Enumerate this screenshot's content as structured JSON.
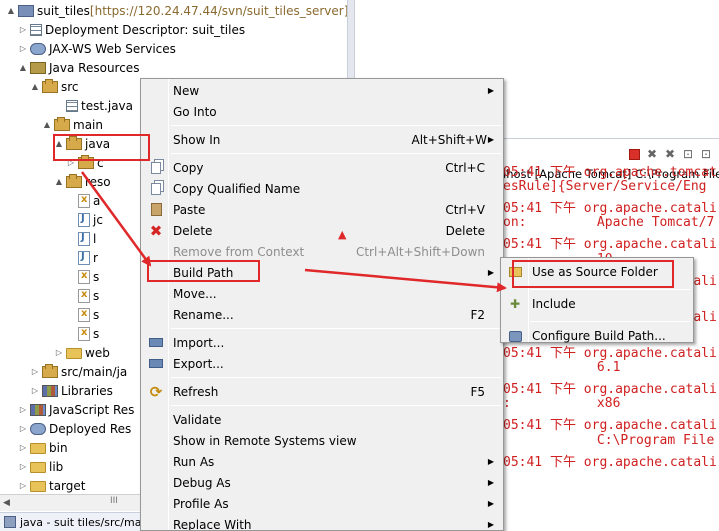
{
  "explorer": {
    "items": [
      {
        "indent": 0,
        "twisty": "▲",
        "icon": "proj",
        "icon_name": "project-icon",
        "label": "suit_tiles",
        "extra": " [https://120.24.47.44/svn/suit_tiles_server]"
      },
      {
        "indent": 1,
        "twisty": "▷",
        "icon": "grid",
        "icon_name": "deployment-descriptor-icon",
        "label": "Deployment Descriptor: suit_tiles"
      },
      {
        "indent": 1,
        "twisty": "▷",
        "icon": "ws",
        "icon_name": "web-services-icon",
        "label": "JAX-WS Web Services"
      },
      {
        "indent": 1,
        "twisty": "▲",
        "icon": "jsr",
        "icon_name": "java-resources-icon",
        "label": "Java Resources"
      },
      {
        "indent": 2,
        "twisty": "▲",
        "icon": "pkg",
        "icon_name": "source-folder-icon",
        "label": "src"
      },
      {
        "indent": 4,
        "twisty": "",
        "icon": "grid",
        "icon_name": "java-file-icon",
        "label": "test.java"
      },
      {
        "indent": 3,
        "twisty": "▲",
        "icon": "pkg",
        "icon_name": "package-icon",
        "label": "main"
      },
      {
        "indent": 4,
        "twisty": "▲",
        "icon": "pkg",
        "icon_name": "package-icon",
        "label": "java"
      },
      {
        "indent": 5,
        "twisty": "▷",
        "icon": "pkg",
        "icon_name": "package-icon",
        "label": "c"
      },
      {
        "indent": 4,
        "twisty": "▲",
        "icon": "pkg",
        "icon_name": "package-icon",
        "label": "reso"
      },
      {
        "indent": 5,
        "twisty": "",
        "icon": "xml",
        "icon_name": "xml-file-icon",
        "label": "a"
      },
      {
        "indent": 5,
        "twisty": "",
        "icon": "java",
        "icon_name": "file-icon",
        "label": "jc"
      },
      {
        "indent": 5,
        "twisty": "",
        "icon": "java",
        "icon_name": "file-icon",
        "label": "l"
      },
      {
        "indent": 5,
        "twisty": "",
        "icon": "java",
        "icon_name": "file-icon",
        "label": "r"
      },
      {
        "indent": 5,
        "twisty": "",
        "icon": "xml",
        "icon_name": "xml-file-icon",
        "label": "s"
      },
      {
        "indent": 5,
        "twisty": "",
        "icon": "xml",
        "icon_name": "xml-file-icon",
        "label": "s"
      },
      {
        "indent": 5,
        "twisty": "",
        "icon": "xml",
        "icon_name": "xml-file-icon",
        "label": "s"
      },
      {
        "indent": 5,
        "twisty": "",
        "icon": "xml",
        "icon_name": "xml-file-icon",
        "label": "s"
      },
      {
        "indent": 4,
        "twisty": "▷",
        "icon": "folder",
        "icon_name": "folder-icon",
        "label": "web"
      },
      {
        "indent": 2,
        "twisty": "▷",
        "icon": "pkg",
        "icon_name": "source-folder-icon",
        "label": "src/main/ja"
      },
      {
        "indent": 2,
        "twisty": "▷",
        "icon": "lib",
        "icon_name": "libraries-icon",
        "label": "Libraries"
      },
      {
        "indent": 1,
        "twisty": "▷",
        "icon": "lib",
        "icon_name": "javascript-resources-icon",
        "label": "JavaScript Res"
      },
      {
        "indent": 1,
        "twisty": "▷",
        "icon": "ws",
        "icon_name": "deployed-resources-icon",
        "label": "Deployed Res"
      },
      {
        "indent": 1,
        "twisty": "▷",
        "icon": "folder",
        "icon_name": "folder-icon",
        "label": "bin"
      },
      {
        "indent": 1,
        "twisty": "▷",
        "icon": "folder",
        "icon_name": "folder-icon",
        "label": "lib"
      },
      {
        "indent": 1,
        "twisty": "▷",
        "icon": "folder",
        "icon_name": "folder-icon",
        "label": "target"
      }
    ],
    "scroll_left": "◀",
    "scroll_right": "▶",
    "scroll_thumb": "III",
    "status_text": "java - suit tiles/src/ma"
  },
  "console": {
    "header": "lhost [Apache Tomcat] C:\\Program File",
    "toolbar_icons": [
      "■",
      "✖",
      "✖",
      "⊡",
      "⊡"
    ],
    "lines": [
      "05:41 下午 org.apache.tomcat",
      "esRule]{Server/Service/Eng",
      "05:41 下午 org.apache.catali",
      "on:         Apache Tomcat/7",
      "05:41 下午 org.apache.catali",
      "            10",
      "05:41 下午 org.apache.catali",
      "",
      "05:41 下午 org.apache.catali",
      "            Windows 7",
      "05:41 下午 org.apache.catali",
      "            6.1",
      "05:41 下午 org.apache.catali",
      ":           x86",
      "05:41 下午 org.apache.catali",
      "            C:\\Program File",
      "05:41 下午 org.apache.catali"
    ]
  },
  "context_menu": {
    "items": [
      {
        "type": "item",
        "label": "New",
        "shortcut": "",
        "submenu": true,
        "icon": "",
        "name": "menu-item-new"
      },
      {
        "type": "item",
        "label": "Go Into",
        "shortcut": "",
        "submenu": false,
        "icon": "",
        "name": "menu-item-go-into"
      },
      {
        "type": "sep"
      },
      {
        "type": "item",
        "label": "Show In",
        "shortcut": "Alt+Shift+W",
        "submenu": true,
        "icon": "",
        "name": "menu-item-show-in"
      },
      {
        "type": "sep"
      },
      {
        "type": "item",
        "label": "Copy",
        "shortcut": "Ctrl+C",
        "submenu": false,
        "icon": "copy",
        "name": "menu-item-copy"
      },
      {
        "type": "item",
        "label": "Copy Qualified Name",
        "shortcut": "",
        "submenu": false,
        "icon": "copy",
        "name": "menu-item-copy-qualified-name"
      },
      {
        "type": "item",
        "label": "Paste",
        "shortcut": "Ctrl+V",
        "submenu": false,
        "icon": "paste",
        "name": "menu-item-paste"
      },
      {
        "type": "item",
        "label": "Delete",
        "shortcut": "Delete",
        "submenu": false,
        "icon": "del",
        "name": "menu-item-delete"
      },
      {
        "type": "item",
        "label": "Remove from Context",
        "shortcut": "Ctrl+Alt+Shift+Down",
        "submenu": false,
        "icon": "",
        "disabled": true,
        "name": "menu-item-remove-from-context"
      },
      {
        "type": "item",
        "label": "Build Path",
        "shortcut": "",
        "submenu": true,
        "icon": "",
        "name": "menu-item-build-path"
      },
      {
        "type": "item",
        "label": "Move...",
        "shortcut": "",
        "submenu": false,
        "icon": "",
        "name": "menu-item-move"
      },
      {
        "type": "item",
        "label": "Rename...",
        "shortcut": "F2",
        "submenu": false,
        "icon": "",
        "name": "menu-item-rename"
      },
      {
        "type": "sep"
      },
      {
        "type": "item",
        "label": "Import...",
        "shortcut": "",
        "submenu": false,
        "icon": "imp",
        "name": "menu-item-import"
      },
      {
        "type": "item",
        "label": "Export...",
        "shortcut": "",
        "submenu": false,
        "icon": "imp",
        "name": "menu-item-export"
      },
      {
        "type": "sep"
      },
      {
        "type": "item",
        "label": "Refresh",
        "shortcut": "F5",
        "submenu": false,
        "icon": "ref",
        "name": "menu-item-refresh"
      },
      {
        "type": "sep"
      },
      {
        "type": "item",
        "label": "Validate",
        "shortcut": "",
        "submenu": false,
        "icon": "",
        "name": "menu-item-validate"
      },
      {
        "type": "item",
        "label": "Show in Remote Systems view",
        "shortcut": "",
        "submenu": false,
        "icon": "",
        "name": "menu-item-show-remote-systems"
      },
      {
        "type": "item",
        "label": "Run As",
        "shortcut": "",
        "submenu": true,
        "icon": "",
        "name": "menu-item-run-as"
      },
      {
        "type": "item",
        "label": "Debug As",
        "shortcut": "",
        "submenu": true,
        "icon": "",
        "name": "menu-item-debug-as"
      },
      {
        "type": "item",
        "label": "Profile As",
        "shortcut": "",
        "submenu": true,
        "icon": "",
        "name": "menu-item-profile-as"
      },
      {
        "type": "item",
        "label": "Replace With",
        "shortcut": "",
        "submenu": true,
        "icon": "",
        "name": "menu-item-replace-with"
      }
    ],
    "submenu_arrow": "▶",
    "delete_glyph": "✖",
    "refresh_glyph": "⟳"
  },
  "build_path_submenu": {
    "items": [
      {
        "label": "Use as Source Folder",
        "icon": "src",
        "name": "submenu-item-use-as-source-folder"
      },
      {
        "type": "sep"
      },
      {
        "label": "Include",
        "icon": "inc",
        "name": "submenu-item-include",
        "glyph": "✚"
      },
      {
        "type": "sep"
      },
      {
        "label": "Configure Build Path...",
        "icon": "cfg",
        "name": "submenu-item-configure-build-path"
      }
    ]
  },
  "annotation": {
    "color": "#e0282a",
    "cursor_glyph": "▲"
  }
}
